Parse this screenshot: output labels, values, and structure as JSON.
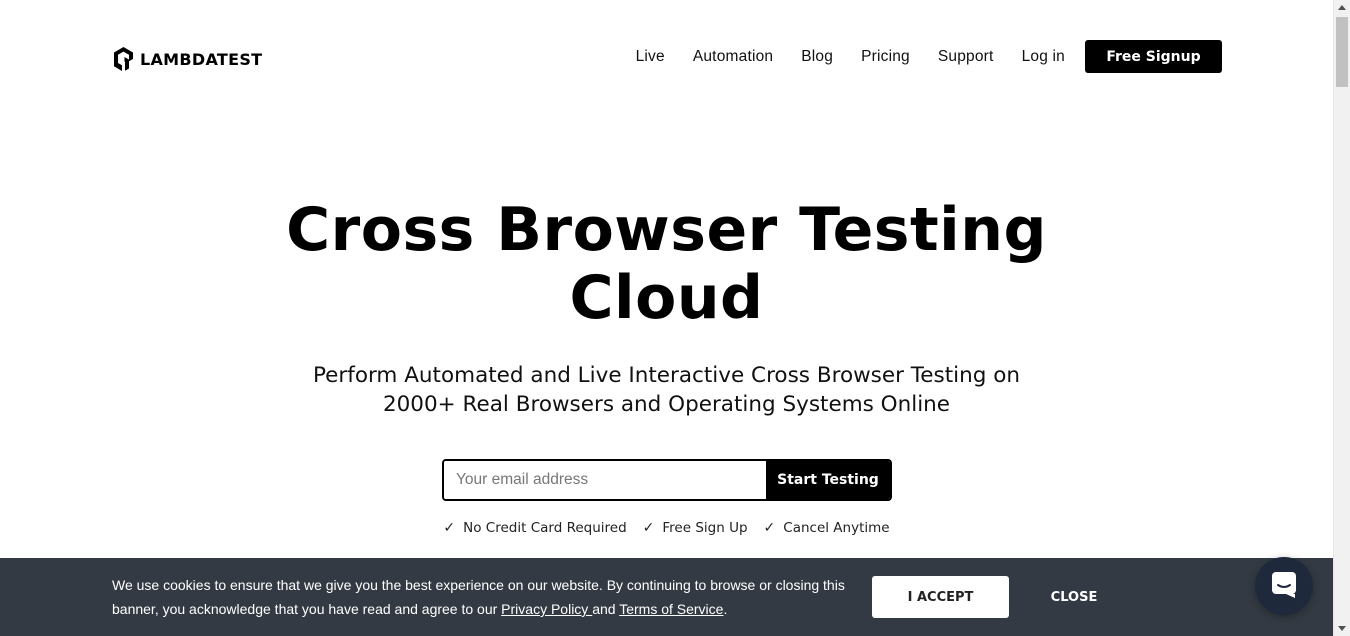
{
  "header": {
    "logo_text": "LAMBDATEST",
    "nav": [
      {
        "label": "Live"
      },
      {
        "label": "Automation"
      },
      {
        "label": "Blog"
      },
      {
        "label": "Pricing"
      },
      {
        "label": "Support"
      },
      {
        "label": "Log in"
      }
    ],
    "signup_label": "Free Signup"
  },
  "hero": {
    "title_line1": "Cross Browser Testing",
    "title_line2": "Cloud",
    "subtitle_line1": "Perform Automated and Live Interactive Cross Browser Testing on",
    "subtitle_line2": "2000+ Real Browsers and Operating Systems Online",
    "email_placeholder": "Your email address",
    "start_button_label": "Start Testing",
    "perks": [
      {
        "icon": "check-icon",
        "label": "No Credit Card Required"
      },
      {
        "icon": "check-icon",
        "label": "Free Sign Up"
      },
      {
        "icon": "check-icon",
        "label": "Cancel Anytime"
      }
    ]
  },
  "cookie_banner": {
    "text_line1": "We use cookies to ensure that we give you the best experience on our website. By continuing to browse or closing this",
    "text_line2_before": "banner, you acknowledge that you have read and agree to our ",
    "privacy_link": "Privacy Policy ",
    "text_and": "and ",
    "terms_link": "Terms of Service",
    "text_end": ".",
    "accept_label": "I ACCEPT",
    "close_label": "CLOSE"
  },
  "chat": {
    "icon": "chat-icon"
  },
  "colors": {
    "banner_bg": "#333a43",
    "button_dark": "#000000",
    "chat_bg": "#1e2a3c"
  }
}
